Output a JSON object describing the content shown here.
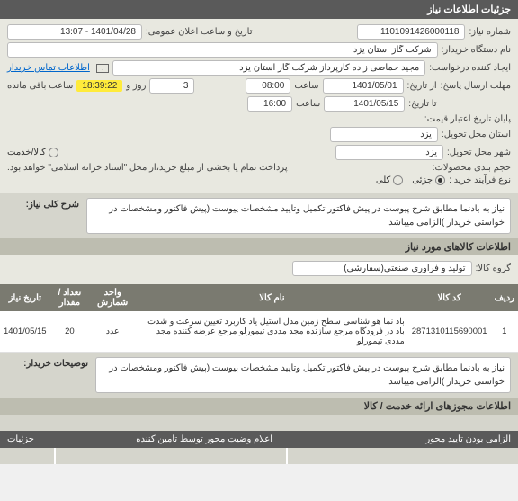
{
  "header": {
    "title": "جزئیات اطلاعات نیاز"
  },
  "form": {
    "need_no_label": "شماره نیاز:",
    "need_no": "1101091426000118",
    "pub_date_label": "تاریخ و ساعت اعلان عمومی:",
    "pub_date": "1401/04/28 - 13:07",
    "buyer_org_label": "نام دستگاه خریدار:",
    "buyer_org": "شرکت گاز استان یزد",
    "requester_label": "ایجاد کننده درخواست:",
    "requester": "مجید حماصی زاده کارپرداز شرکت گاز استان یزد",
    "contact_link": "اطلاعات تماس خریدار",
    "deadline_label": "مهلت ارسال پاسخ:",
    "from_label": "از تاریخ:",
    "from_date": "1401/05/01",
    "hour_label": "ساعت",
    "from_hour": "08:00",
    "days": "3",
    "days_unit": "روز و",
    "time_left": "18:39:22",
    "time_left_label": "ساعت باقی مانده",
    "to_label": "تا تاریخ:",
    "to_date": "1401/05/15",
    "to_hour": "16:00",
    "credit_expiry_label": "پایان تاریخ اعتبار قیمت:",
    "province_label": "استان محل تحویل:",
    "province": "یزد",
    "city_label": "شهر محل تحویل:",
    "city": "یزد",
    "has_copy_label": "حجم بندی محصولات:",
    "proc_type_label": "نوع فرآیند خرید :",
    "partial_opt": "جزئی",
    "full_opt": "کلی",
    "goods_svc_opt": "کالا/خدمت",
    "payment_note": "پرداخت تمام یا بخشی از مبلغ خرید،از محل \"اسناد خزانه اسلامی\" خواهد بود."
  },
  "desc": {
    "title": "شرح کلی نیاز:",
    "text": "نیاز به بادنما مطابق شرح پیوست در پیش فاکتور تکمیل وتایید مشخصات پیوست (پیش فاکتور ومشخصات در خواستی خریدار )الزامی میباشد"
  },
  "items_section": {
    "title": "اطلاعات کالاهای مورد نیاز",
    "group_label": "گروه کالا:",
    "group": "تولید و فرآوری صنعتی(سفارشی)"
  },
  "table": {
    "headers": [
      "ردیف",
      "کد کالا",
      "نام کالا",
      "واحد شمارش",
      "تعداد / مقدار",
      "تاریخ نیاز"
    ],
    "row": {
      "idx": "1",
      "code": "2871310115690001",
      "name": "باد نما هواشناسی سطح زمین مدل استیل یاد کاربرد تعیین سرعت و شدت باد در فرودگاه مرجع سازنده مجد مددی تیمورلو مرجع عرضه کننده مجد مددی تیمورلو",
      "unit": "عدد",
      "qty": "20",
      "date": "1401/05/15"
    }
  },
  "explain": {
    "label": "توضیحات خریدار:",
    "text": "نیاز به بادنما مطابق شرح پیوست در پیش فاکتور تکمیل وتایید مشخصات پیوست (پیش فاکتور ومشخصات در خواستی خریدار )الزامی میباشد"
  },
  "permits_section": {
    "title": "اطلاعات مجوزهای ارائه خدمت / کالا"
  },
  "footer": {
    "col1": "الزامی بودن تایید محور",
    "col2": "اعلام وضیت محور توسط تامین کننده",
    "col3": "جزئیات"
  }
}
